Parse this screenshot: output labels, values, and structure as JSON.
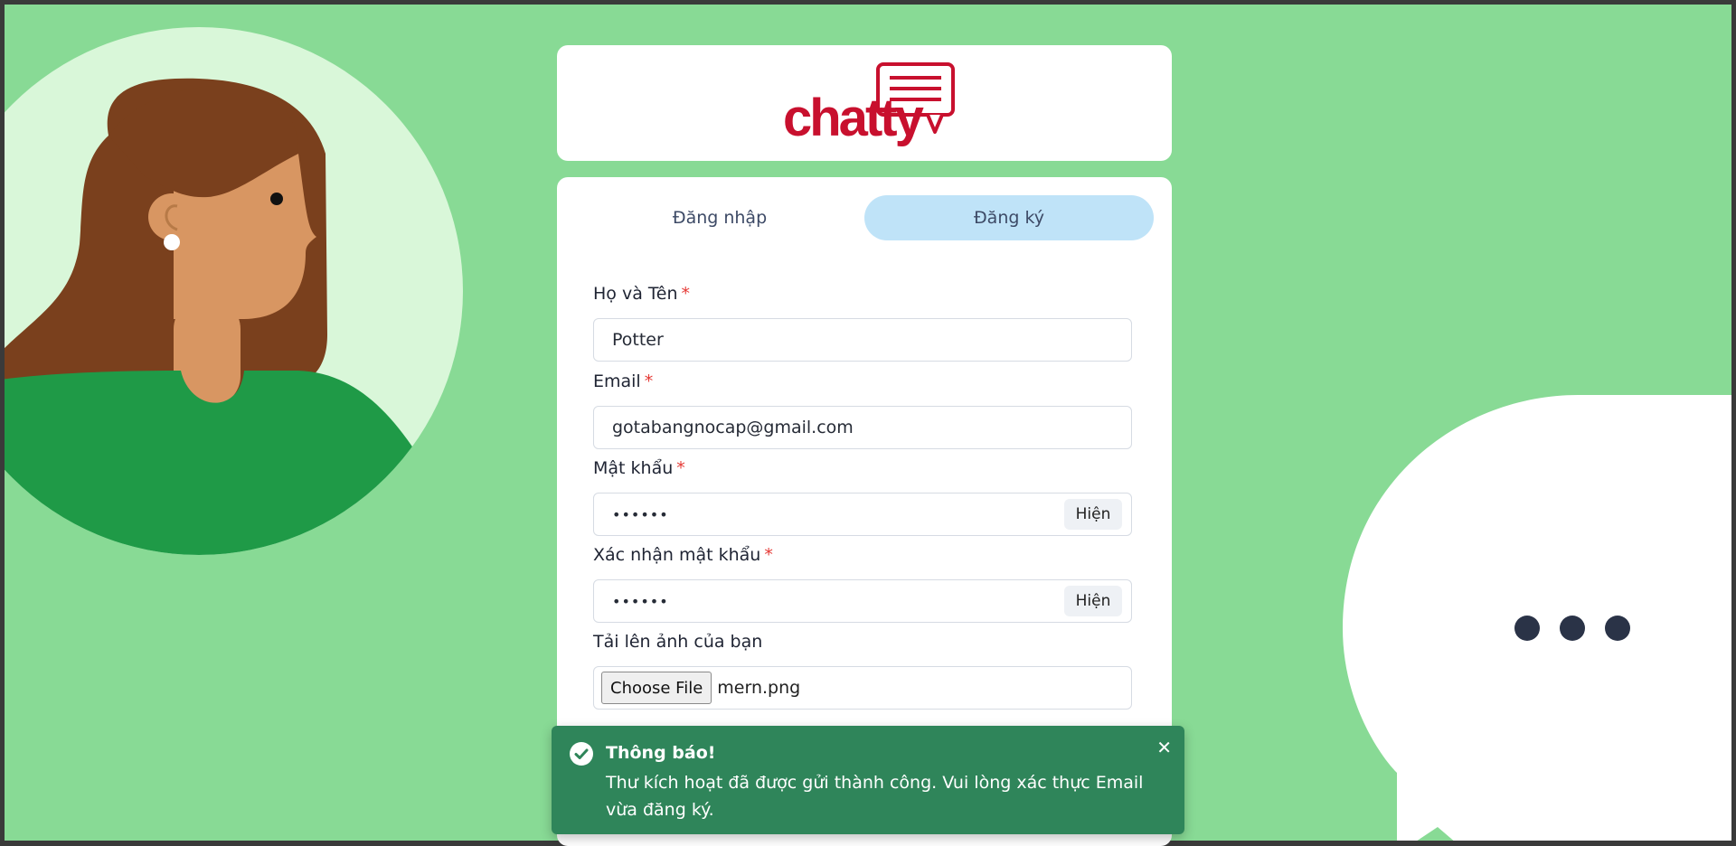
{
  "logo": {
    "text": "chatty",
    "color": "#c8102e"
  },
  "tabs": [
    {
      "label": "Đăng nhập",
      "active": false
    },
    {
      "label": "Đăng ký",
      "active": true
    }
  ],
  "form": {
    "name": {
      "label": "Họ và Tên",
      "required_mark": "*",
      "value": "Potter"
    },
    "email": {
      "label": "Email",
      "required_mark": "*",
      "value": "gotabangnocap@gmail.com"
    },
    "password": {
      "label": "Mật khẩu",
      "required_mark": "*",
      "value": "••••••",
      "toggle_label": "Hiện"
    },
    "confirm_password": {
      "label": "Xác nhận mật khẩu",
      "required_mark": "*",
      "value": "••••••",
      "toggle_label": "Hiện"
    },
    "avatar_upload": {
      "label": "Tải lên ảnh của bạn",
      "button_label": "Choose File",
      "file_name": "mern.png"
    }
  },
  "toast": {
    "icon": "check-circle-icon",
    "title": "Thông báo!",
    "message": "Thư kích hoạt đã được gửi thành công. Vui lòng xác thực Email vừa đăng ký.",
    "close_icon": "close-icon",
    "color": "#2f855a"
  },
  "colors": {
    "background": "#88da95",
    "active_tab": "#bfe3f8",
    "illustration_shirt": "#1f9a47",
    "illustration_hair": "#7a401d",
    "illustration_skin": "#d89662"
  }
}
